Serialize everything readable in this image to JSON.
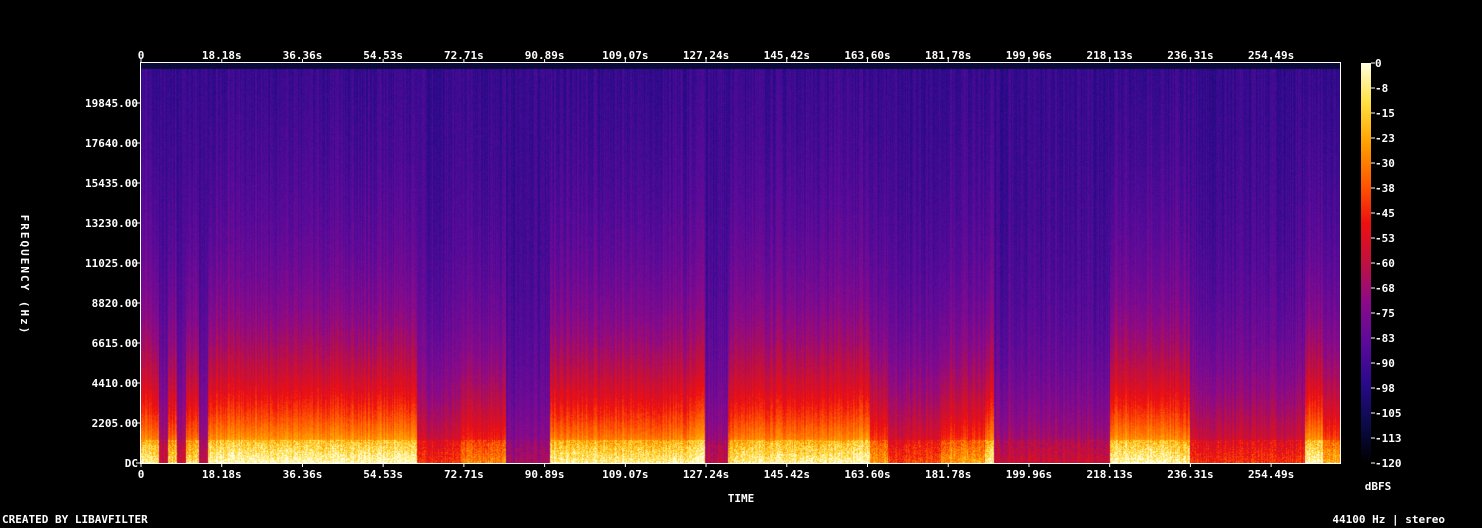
{
  "chart_data": {
    "type": "heatmap",
    "title": "",
    "xlabel": "TIME",
    "ylabel": "FREQUENCY (Hz)",
    "x_ticks": [
      "0",
      "18.18s",
      "36.36s",
      "54.53s",
      "72.71s",
      "90.89s",
      "109.07s",
      "127.24s",
      "145.42s",
      "163.60s",
      "181.78s",
      "199.96s",
      "218.13s",
      "236.31s",
      "254.49s"
    ],
    "x_tick_values": [
      0,
      18.18,
      36.36,
      54.53,
      72.71,
      90.89,
      109.07,
      127.24,
      145.42,
      163.6,
      181.78,
      199.96,
      218.13,
      236.31,
      254.49
    ],
    "xlim": [
      0,
      270
    ],
    "y_ticks": [
      "DC",
      "2205.00",
      "4410.00",
      "6615.00",
      "8820.00",
      "11025.00",
      "13230.00",
      "15435.00",
      "17640.00",
      "19845.00"
    ],
    "y_tick_values": [
      0,
      2205,
      4410,
      6615,
      8820,
      11025,
      13230,
      15435,
      17640,
      19845
    ],
    "ylim": [
      0,
      22050
    ],
    "colorbar": {
      "label": "dBFS",
      "ticks": [
        "0",
        "-8",
        "-15",
        "-23",
        "-30",
        "-38",
        "-45",
        "-53",
        "-60",
        "-68",
        "-75",
        "-83",
        "-90",
        "-98",
        "-105",
        "-113",
        "-120"
      ],
      "range": [
        -120,
        0
      ],
      "colors": [
        "#000000",
        "#0b0b4a",
        "#2a0a8a",
        "#5a0a9a",
        "#8a0a8a",
        "#c01040",
        "#ee1010",
        "#ff5a00",
        "#ffa000",
        "#ffe040",
        "#ffffe0"
      ]
    },
    "energy_profile": {
      "time_breaks": [
        0,
        4,
        6,
        8,
        10,
        13,
        15,
        60,
        62,
        72,
        80,
        82,
        92,
        94,
        124,
        127,
        132,
        135,
        160,
        164,
        168,
        172,
        180,
        190,
        192,
        218,
        232,
        236,
        262,
        266,
        270
      ],
      "levels": [
        0.95,
        0.4,
        0.9,
        0.4,
        0.9,
        0.35,
        1.0,
        1.0,
        0.55,
        0.7,
        0.72,
        0.3,
        0.95,
        0.95,
        1.0,
        0.35,
        0.9,
        0.95,
        1.0,
        0.75,
        0.55,
        0.6,
        0.75,
        0.95,
        0.4,
        1.0,
        0.95,
        0.55,
        1.0,
        0.8,
        0.1
      ]
    }
  },
  "footer": {
    "left": "CREATED BY LIBAVFILTER",
    "right": "44100 Hz | stereo"
  }
}
